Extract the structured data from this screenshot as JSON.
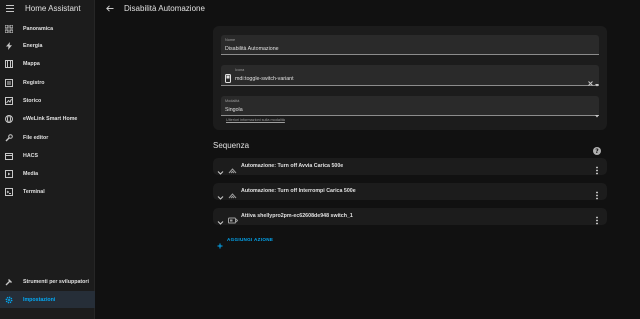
{
  "sidebar": {
    "title": "Home Assistant",
    "items": [
      {
        "label": "Panoramica",
        "icon": "grid-icon"
      },
      {
        "label": "Energia",
        "icon": "lightning-icon"
      },
      {
        "label": "Mappa",
        "icon": "map-icon"
      },
      {
        "label": "Registro",
        "icon": "list-icon"
      },
      {
        "label": "Storico",
        "icon": "chart-icon"
      },
      {
        "label": "eWeLink Smart Home",
        "icon": "globe-icon"
      },
      {
        "label": "File editor",
        "icon": "wrench-icon"
      },
      {
        "label": "HACS",
        "icon": "hacs-icon"
      },
      {
        "label": "Media",
        "icon": "media-icon"
      },
      {
        "label": "Terminal",
        "icon": "terminal-icon"
      }
    ],
    "bottom_items": [
      {
        "label": "Strumenti per sviluppatori",
        "icon": "hammer-icon"
      },
      {
        "label": "Impostazioni",
        "icon": "cog-icon",
        "active": true
      }
    ]
  },
  "topbar": {
    "title": "Disabilità Automazione"
  },
  "form": {
    "name": {
      "label": "Nome",
      "value": "Disabilità Automazione"
    },
    "icon": {
      "label": "Icona",
      "value": "mdi:toggle-switch-variant"
    },
    "mode": {
      "label": "Modalità",
      "value": "Singola"
    },
    "helper_link": "Ulteriori informazioni sulla modalità"
  },
  "sequence": {
    "title": "Sequenza",
    "actions": [
      {
        "label": "Automazione: Turn off Avvia Carica 500e",
        "icon": "robot-icon"
      },
      {
        "label": "Automazione: Turn off Interrompi Carica 500e",
        "icon": "robot-icon"
      },
      {
        "label": "Attiva shellypro2pm-ec62608de948 switch_1",
        "icon": "switch-icon"
      }
    ],
    "add_label": "AGGIUNGI AZIONE"
  },
  "colors": {
    "accent": "#03a9f4",
    "background": "#111111",
    "card": "#1c1c1c"
  }
}
